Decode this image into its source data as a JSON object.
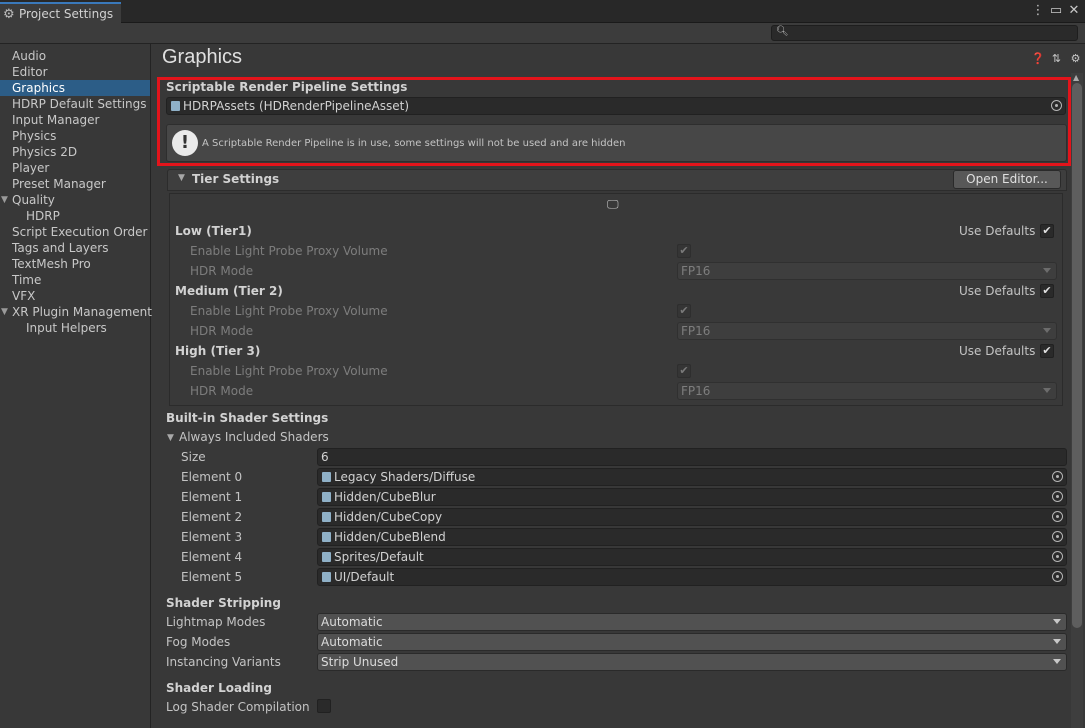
{
  "window": {
    "tab_title": "Project Settings",
    "controls": [
      "more-icon",
      "maximize-icon",
      "close-icon"
    ]
  },
  "search": {
    "placeholder": ""
  },
  "sidebar": {
    "items": [
      {
        "label": "Audio"
      },
      {
        "label": "Editor"
      },
      {
        "label": "Graphics",
        "selected": true
      },
      {
        "label": "HDRP Default Settings"
      },
      {
        "label": "Input Manager"
      },
      {
        "label": "Physics"
      },
      {
        "label": "Physics 2D"
      },
      {
        "label": "Player"
      },
      {
        "label": "Preset Manager"
      },
      {
        "label": "Quality",
        "expandable": true
      },
      {
        "label": "HDRP",
        "child": true
      },
      {
        "label": "Script Execution Order"
      },
      {
        "label": "Tags and Layers"
      },
      {
        "label": "TextMesh Pro"
      },
      {
        "label": "Time"
      },
      {
        "label": "VFX"
      },
      {
        "label": "XR Plugin Management",
        "expandable": true
      },
      {
        "label": "Input Helpers",
        "child": true
      }
    ]
  },
  "main": {
    "title": "Graphics",
    "srp": {
      "heading": "Scriptable Render Pipeline Settings",
      "asset": "HDRPAssets (HDRenderPipelineAsset)",
      "help": "A Scriptable Render Pipeline is in use, some settings will not be used and are hidden"
    },
    "tier": {
      "heading": "Tier Settings",
      "open_editor": "Open Editor...",
      "tiers": [
        {
          "name": "Low (Tier1)",
          "use_defaults": "Use Defaults",
          "proxy_label": "Enable Light Probe Proxy Volume",
          "hdr_label": "HDR Mode",
          "hdr_value": "FP16"
        },
        {
          "name": "Medium (Tier 2)",
          "use_defaults": "Use Defaults",
          "proxy_label": "Enable Light Probe Proxy Volume",
          "hdr_label": "HDR Mode",
          "hdr_value": "FP16"
        },
        {
          "name": "High (Tier 3)",
          "use_defaults": "Use Defaults",
          "proxy_label": "Enable Light Probe Proxy Volume",
          "hdr_label": "HDR Mode",
          "hdr_value": "FP16"
        }
      ]
    },
    "builtin": {
      "heading": "Built-in Shader Settings",
      "always_included": "Always Included Shaders",
      "size_label": "Size",
      "size_value": "6",
      "elements": [
        {
          "label": "Element 0",
          "value": "Legacy Shaders/Diffuse"
        },
        {
          "label": "Element 1",
          "value": "Hidden/CubeBlur"
        },
        {
          "label": "Element 2",
          "value": "Hidden/CubeCopy"
        },
        {
          "label": "Element 3",
          "value": "Hidden/CubeBlend"
        },
        {
          "label": "Element 4",
          "value": "Sprites/Default"
        },
        {
          "label": "Element 5",
          "value": "UI/Default"
        }
      ]
    },
    "stripping": {
      "heading": "Shader Stripping",
      "lightmap_label": "Lightmap Modes",
      "lightmap_value": "Automatic",
      "fog_label": "Fog Modes",
      "fog_value": "Automatic",
      "instancing_label": "Instancing Variants",
      "instancing_value": "Strip Unused"
    },
    "loading": {
      "heading": "Shader Loading",
      "log_label": "Log Shader Compilation"
    }
  },
  "colors": {
    "accent": "#2c5d87",
    "highlight": "#e3141b",
    "tab_accent": "#3a79bb"
  }
}
